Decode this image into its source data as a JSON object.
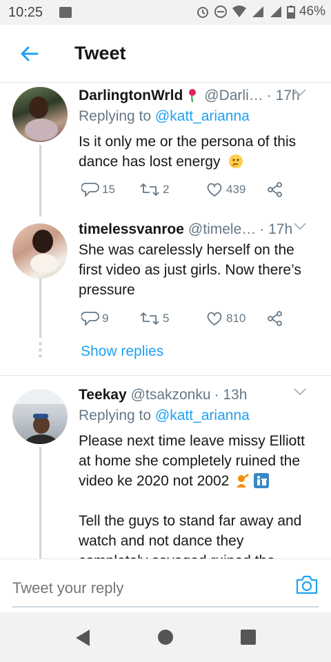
{
  "status_bar": {
    "time": "10:25",
    "battery": "46%"
  },
  "header": {
    "title": "Tweet"
  },
  "tweets": [
    {
      "name": "DarlingtonWrld",
      "handle": "@Darli…",
      "time": "· 17h",
      "replying_prefix": "Replying to",
      "replying_to": "@katt_arianna",
      "text_lines": [
        "Is it only me or the persona of this",
        "dance has lost energy"
      ],
      "replies": "15",
      "retweets": "2",
      "likes": "439"
    },
    {
      "name": "timelessvanroe",
      "handle": "@timele…",
      "time": "· 17h",
      "text_lines": [
        "She was carelessly herself on the",
        "first video as just girls. Now there’s",
        "pressure"
      ],
      "replies": "9",
      "retweets": "5",
      "likes": "810",
      "show_replies": "Show replies"
    },
    {
      "name": "Teekay",
      "handle": "@tsakzonku",
      "time": "· 13h",
      "replying_prefix": "Replying to",
      "replying_to": "@katt_arianna",
      "text_lines": [
        "Please next time leave missy Elliott",
        "at home she completely ruined the",
        "video ke 2020 not 2002",
        "",
        "Tell the guys to stand far away and",
        "watch and not dance they",
        "completely savaged ruined the"
      ]
    }
  ],
  "reply_bar": {
    "placeholder": "Tweet your reply"
  },
  "colors": {
    "accent": "#1da1f2",
    "secondary_text": "#657786",
    "divider": "#e1e8ed"
  }
}
